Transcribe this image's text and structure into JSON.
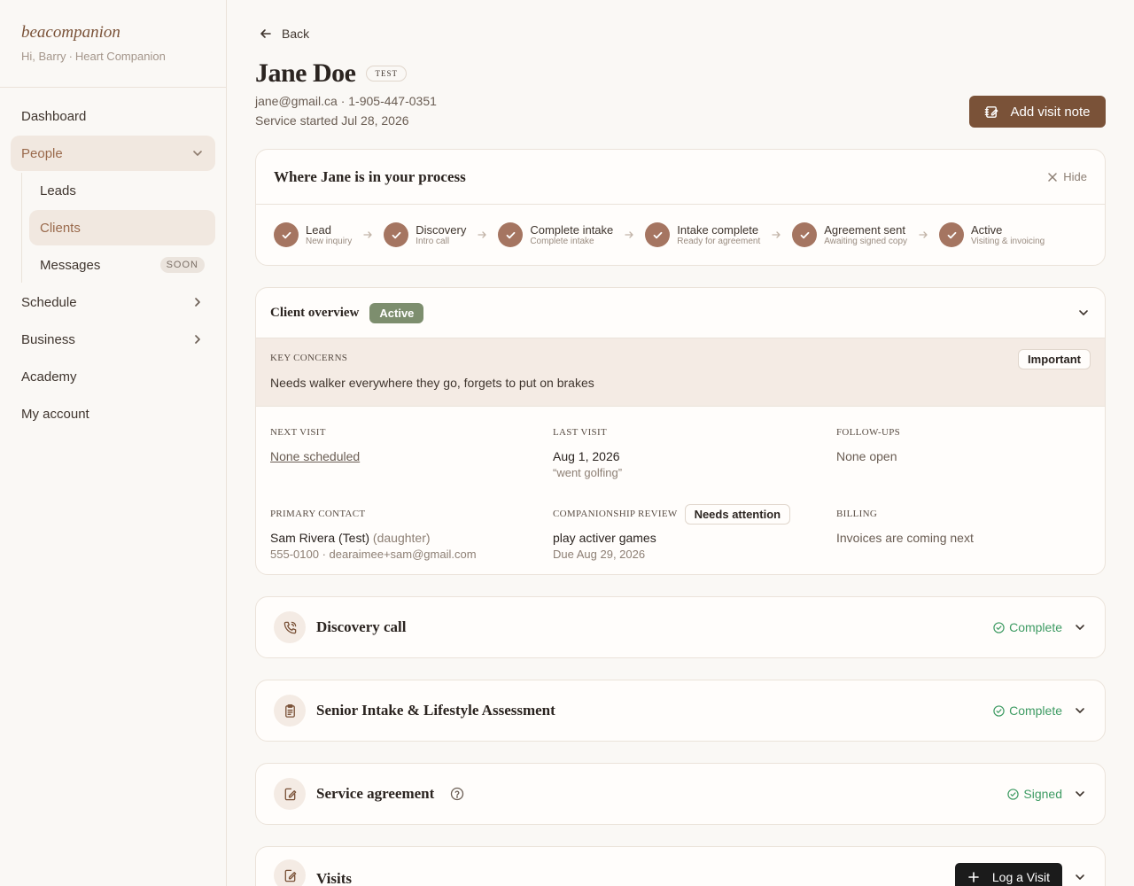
{
  "brand": {
    "name": "beacompanion",
    "greeting": "Hi, Barry",
    "role": "Heart Companion"
  },
  "nav": {
    "dashboard": "Dashboard",
    "people": "People",
    "leads": "Leads",
    "clients": "Clients",
    "messages": "Messages",
    "soon": "SOON",
    "schedule": "Schedule",
    "business": "Business",
    "academy": "Academy",
    "my_account": "My account"
  },
  "header": {
    "back": "Back",
    "name": "Jane Doe",
    "test_badge": "TEST",
    "email": "jane@gmail.ca",
    "phone": "1-905-447-0351",
    "started": "Service started Jul 28, 2026",
    "add_note": "Add visit note"
  },
  "process": {
    "title": "Where Jane is in your process",
    "hide": "Hide",
    "steps": [
      {
        "label": "Lead",
        "sub": "New inquiry"
      },
      {
        "label": "Discovery",
        "sub": "Intro call"
      },
      {
        "label": "Complete intake",
        "sub": "Complete intake"
      },
      {
        "label": "Intake complete",
        "sub": "Ready for agreement"
      },
      {
        "label": "Agreement sent",
        "sub": "Awaiting signed copy"
      },
      {
        "label": "Active",
        "sub": "Visiting & invoicing"
      }
    ]
  },
  "overview": {
    "title": "Client overview",
    "status": "Active",
    "key_concerns_label": "KEY CONCERNS",
    "important": "Important",
    "key_concerns": "Needs walker everywhere they go, forgets to put on brakes",
    "next_visit_label": "NEXT VISIT",
    "next_visit": "None scheduled",
    "last_visit_label": "LAST VISIT",
    "last_visit": "Aug 1, 2026",
    "last_visit_note": "“went golfing”",
    "followups_label": "FOLLOW-UPS",
    "followups": "None open",
    "primary_contact_label": "PRIMARY CONTACT",
    "primary_contact_name": "Sam Rivera (Test)",
    "primary_contact_rel": "(daughter)",
    "primary_contact_phone": "555-0100",
    "primary_contact_email": "dearaimee+sam@gmail.com",
    "review_label": "COMPANIONSHIP REVIEW",
    "review_badge": "Needs attention",
    "review_item": "play activer games",
    "review_due": "Due Aug 29, 2026",
    "billing_label": "BILLING",
    "billing": "Invoices are coming next"
  },
  "sections": {
    "discovery_title": "Discovery call",
    "discovery_status": "Complete",
    "intake_title": "Senior Intake & Lifestyle Assessment",
    "intake_status": "Complete",
    "agreement_title": "Service agreement",
    "agreement_status": "Signed",
    "visits_title": "Visits",
    "log_visit": "Log a Visit"
  },
  "colors": {
    "accent": "#7a5238",
    "step": "#a57561",
    "active_badge": "#7d8e6e",
    "success": "#3e9b63"
  }
}
